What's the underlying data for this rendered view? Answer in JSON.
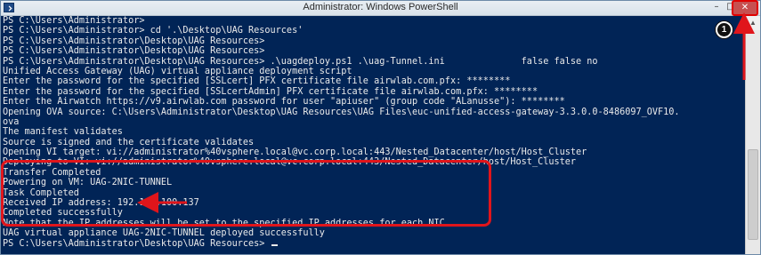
{
  "window": {
    "title": "Administrator: Windows PowerShell",
    "controls": {
      "minimize": "–",
      "maximize": "□",
      "close": "✕"
    }
  },
  "console": {
    "lines": [
      "PS C:\\Users\\Administrator>",
      "PS C:\\Users\\Administrator> cd '.\\Desktop\\UAG Resources'",
      "PS C:\\Users\\Administrator\\Desktop\\UAG Resources>",
      "PS C:\\Users\\Administrator\\Desktop\\UAG Resources>",
      "PS C:\\Users\\Administrator\\Desktop\\UAG Resources> .\\uagdeploy.ps1 .\\uag-Tunnel.ini              false false no",
      "Unified Access Gateway (UAG) virtual appliance deployment script",
      "Enter the password for the specified [SSLcert] PFX certificate file airwlab.com.pfx: ********",
      "Enter the password for the specified [SSLcertAdmin] PFX certificate file airwlab.com.pfx: ********",
      "Enter the Airwatch https://v9.airwlab.com password for user \"apiuser\" (group code \"ALanusse\"): ********",
      "Opening OVA source: C:\\Users\\Administrator\\Desktop\\UAG Resources\\UAG Files\\euc-unified-access-gateway-3.3.0.0-8486097_OVF10.",
      "ova",
      "The manifest validates",
      "Source is signed and the certificate validates",
      "Opening VI target: vi://administrator%40vsphere.local@vc.corp.local:443/Nested_Datacenter/host/Host_Cluster",
      "Deploying to VI: vi://administrator%40vsphere.local@vc.corp.local:443/Nested_Datacenter/host/Host_Cluster",
      "Transfer Completed",
      "Powering on VM: UAG-2NIC-TUNNEL",
      "Task Completed",
      "Received IP address: 192.168.100.137",
      "Completed successfully",
      "Note that the IP addresses will be set to the specified IP addresses for each NIC",
      "UAG virtual appliance UAG-2NIC-TUNNEL deployed successfully",
      "PS C:\\Users\\Administrator\\Desktop\\UAG Resources> "
    ]
  },
  "annotations": {
    "callout_number": "1",
    "highlight_color": "#e0151b"
  },
  "colors": {
    "console_bg": "#012456",
    "console_fg": "#eaeaea"
  }
}
